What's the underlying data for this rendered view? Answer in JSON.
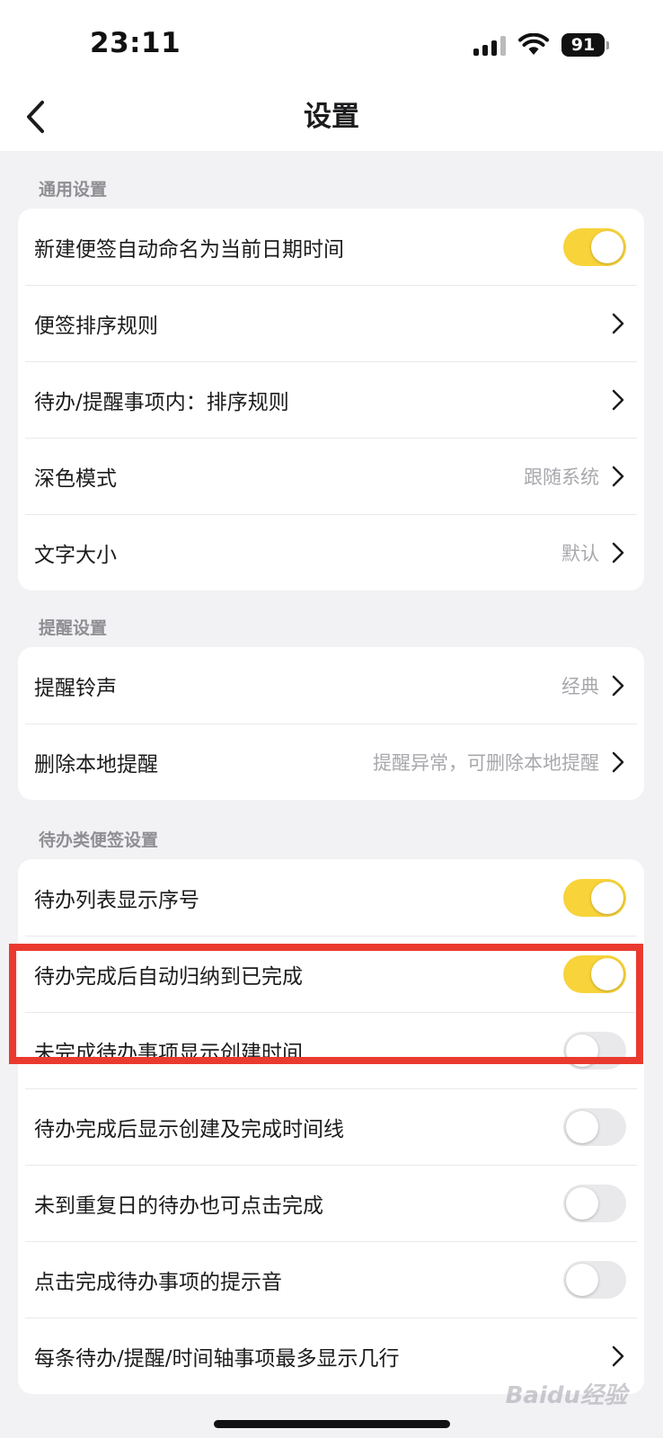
{
  "status_bar": {
    "time": "23:11",
    "battery": "91"
  },
  "header": {
    "title": "设置"
  },
  "sections": [
    {
      "title": "通用设置",
      "rows": [
        {
          "label": "新建便签自动命名为当前日期时间",
          "toggle": true
        },
        {
          "label": "便签排序规则"
        },
        {
          "label": "待办/提醒事项内：排序规则"
        },
        {
          "label": "深色模式",
          "value": "跟随系统"
        },
        {
          "label": "文字大小",
          "value": "默认"
        }
      ]
    },
    {
      "title": "提醒设置",
      "rows": [
        {
          "label": "提醒铃声",
          "value": "经典"
        },
        {
          "label": "删除本地提醒",
          "value": "提醒异常，可删除本地提醒"
        }
      ]
    },
    {
      "title": "待办类便签设置",
      "rows": [
        {
          "label": "待办列表显示序号",
          "toggle": true
        },
        {
          "label": "待办完成后自动归纳到已完成",
          "toggle": true
        },
        {
          "label": "未完成待办事项显示创建时间",
          "toggle": false
        },
        {
          "label": "待办完成后显示创建及完成时间线",
          "toggle": false
        },
        {
          "label": "未到重复日的待办也可点击完成",
          "toggle": false
        },
        {
          "label": "点击完成待办事项的提示音",
          "toggle": false
        },
        {
          "label": "每条待办/提醒/时间轴事项最多显示几行"
        }
      ]
    }
  ],
  "watermark": "Baidu经验",
  "colors": {
    "toggle_on": "#f8d33a",
    "toggle_off": "#e9e9eb",
    "highlight": "#ea3a2f"
  }
}
